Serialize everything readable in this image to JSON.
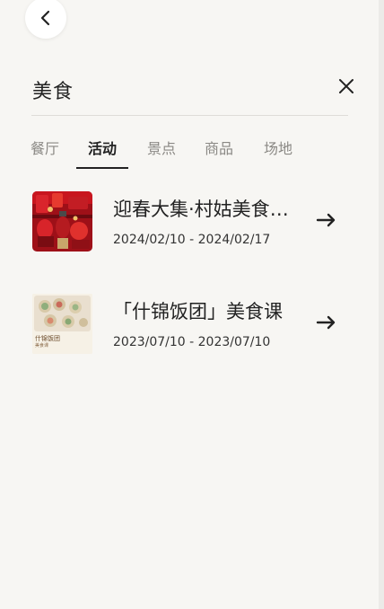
{
  "header": {
    "title": "美食"
  },
  "icons": {
    "back": "chevron-left-icon",
    "close": "close-icon",
    "arrow": "arrow-right-icon"
  },
  "tabs": [
    {
      "label": "餐厅",
      "active": false
    },
    {
      "label": "活动",
      "active": true
    },
    {
      "label": "景点",
      "active": false
    },
    {
      "label": "商品",
      "active": false
    },
    {
      "label": "场地",
      "active": false
    }
  ],
  "results": [
    {
      "title": "迎春大集·村姑美食市集",
      "date": "2024/02/10 - 2024/02/17"
    },
    {
      "title": "「什锦饭团」美食课",
      "date": "2023/07/10 - 2023/07/10",
      "thumb_caption": "什锦饭团",
      "thumb_subcaption": "美食课"
    }
  ],
  "colors": {
    "background": "#f7f6f3",
    "text": "#222222",
    "muted": "#8a8884",
    "festive_red": "#b5121b"
  }
}
